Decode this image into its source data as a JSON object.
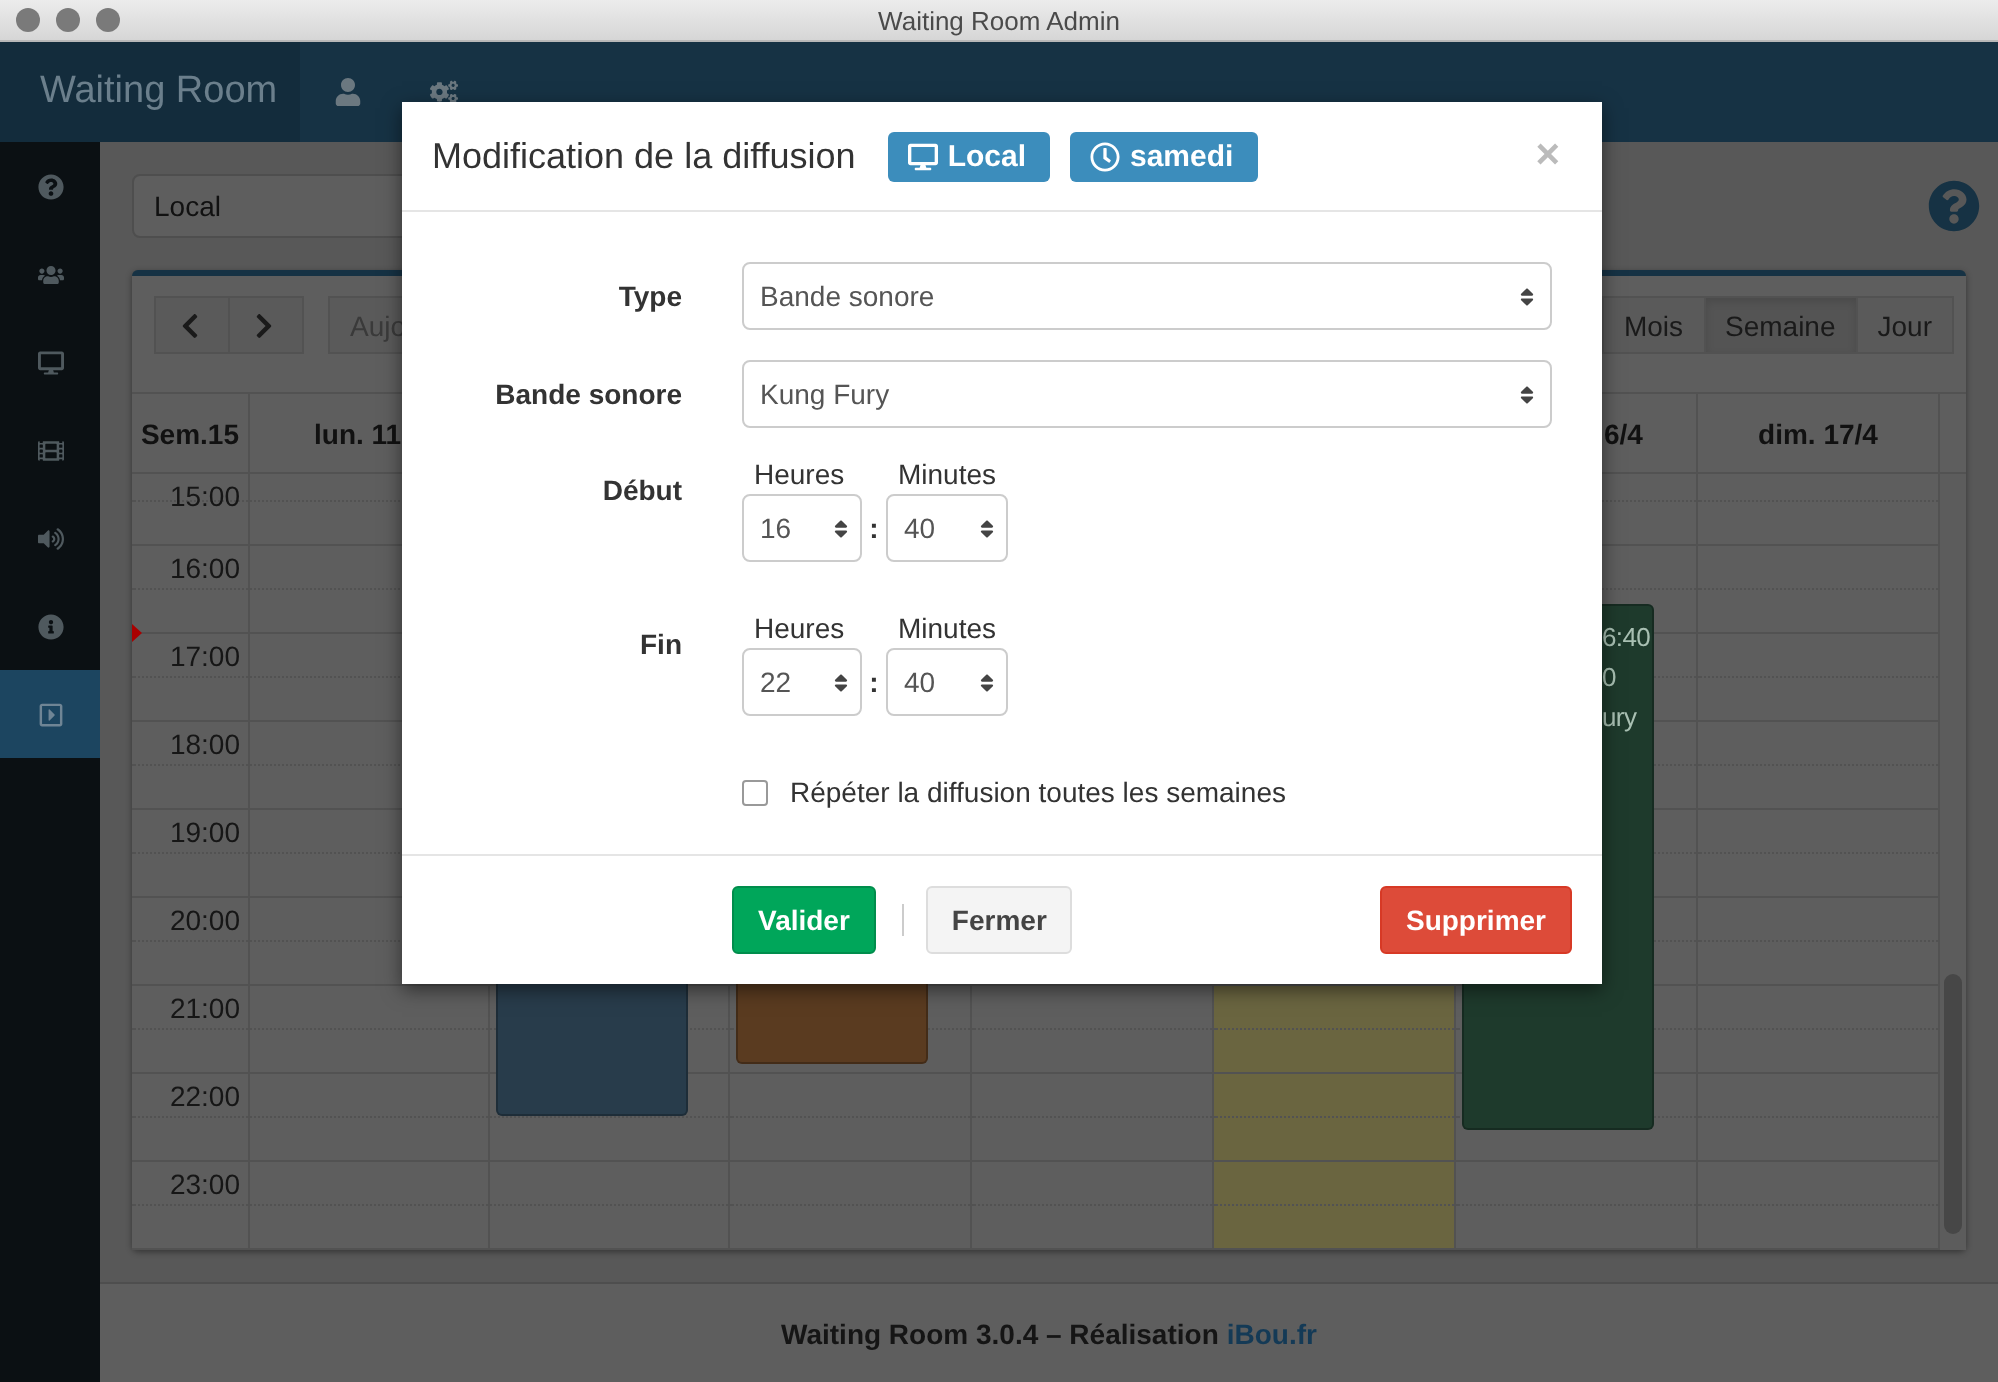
{
  "window": {
    "title": "Waiting Room Admin"
  },
  "navbar": {
    "brand": "Waiting Room"
  },
  "sidebar": {
    "items": [
      {
        "selected": false
      },
      {
        "selected": false
      },
      {
        "selected": false
      },
      {
        "selected": false
      },
      {
        "selected": false
      },
      {
        "selected": false
      },
      {
        "selected": true
      }
    ]
  },
  "location_select": {
    "value": "Local"
  },
  "calendar": {
    "today_button": "Aujo",
    "views": [
      {
        "label": "Mois",
        "selected": false
      },
      {
        "label": "Semaine",
        "selected": true
      },
      {
        "label": "Jour",
        "selected": false
      }
    ],
    "week_label": "Sem.15",
    "hours": [
      "15:00",
      "16:00",
      "17:00",
      "18:00",
      "19:00",
      "20:00",
      "21:00",
      "22:00",
      "23:00"
    ],
    "days": [
      {
        "label": "lun. 11",
        "today": false
      },
      {
        "today": false,
        "events": [
          {
            "color": "#283c4b"
          }
        ]
      },
      {
        "today": false,
        "events": [
          {
            "color": "#5a3b20"
          }
        ]
      },
      {
        "today": false
      },
      {
        "today": true
      },
      {
        "label": "6/4",
        "today": false,
        "events": [
          {
            "color": "#1e3a2c",
            "lines": [
              "6:40",
              "0",
              "ury"
            ]
          }
        ]
      },
      {
        "label": "dim. 17/4",
        "today": false
      }
    ]
  },
  "footer": {
    "text": "Waiting Room 3.0.4 – Réalisation",
    "link": "iBou.fr"
  },
  "modal": {
    "title": "Modification de la diffusion",
    "close": "×",
    "badges": [
      {
        "kind": "screen",
        "label": "Local"
      },
      {
        "kind": "day",
        "label": "samedi"
      }
    ],
    "fields": [
      {
        "label": "Type",
        "value": "Bande sonore"
      },
      {
        "label": "Bande sonore",
        "value": "Kung Fury"
      }
    ],
    "times": [
      {
        "label": "Début",
        "hours_label": "Heures",
        "minutes_label": "Minutes",
        "hours": "16",
        "separator": ":",
        "minutes": "40"
      },
      {
        "label": "Fin",
        "hours_label": "Heures",
        "minutes_label": "Minutes",
        "hours": "22",
        "separator": ":",
        "minutes": "40"
      }
    ],
    "repeat": {
      "label": "Répéter la diffusion toutes les semaines",
      "checked": false
    },
    "buttons": [
      {
        "kind": "primary",
        "label": "Valider"
      },
      {
        "kind": "default",
        "label": "Fermer"
      },
      {
        "kind": "danger",
        "label": "Supprimer"
      }
    ]
  }
}
